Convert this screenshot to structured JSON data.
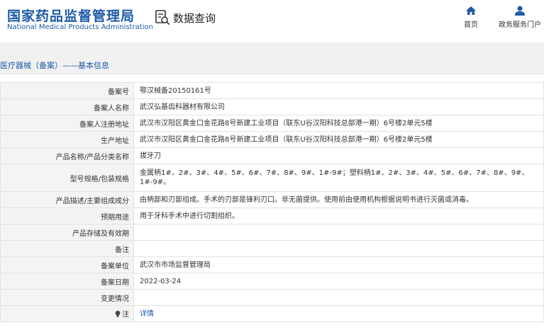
{
  "header": {
    "logo_cn": "国家药品监督管理局",
    "logo_en": "National Medical Products Administration",
    "search_label": "数据查询",
    "nav": [
      {
        "label": "首页",
        "icon": "home-icon"
      },
      {
        "label": "政务服务门户",
        "icon": "user-icon"
      }
    ]
  },
  "colors": {
    "brand": "#1d5aa8",
    "label_bg": "#f4f4f4",
    "section_bg": "#f1f1f1"
  },
  "section_title": "医疗器械（备案）——基本信息",
  "rows": [
    {
      "label": "备案号",
      "value": "鄂汉械备20150161号"
    },
    {
      "label": "备案人名称",
      "value": "武汉弘基齿科器材有限公司"
    },
    {
      "label": "备案人注册地址",
      "value": "武汉市汉阳区黄金口金花路8号新建工业项目（联东U谷汉阳科技总部港一期）6号楼2单元5楼"
    },
    {
      "label": "生产地址",
      "value": "武汉市汉阳区黄金口金花路8号新建工业项目（联东U谷汉阳科技总部港一期）6号楼2单元5楼"
    },
    {
      "label": "产品名称/产品分类名称",
      "value": "拔牙刀"
    },
    {
      "label": "型号规格/包装规格",
      "value": "金属柄1#、2#、3#、4#、5#、6#、7#、8#、9#、1#-9#；塑料柄1#、2#、3#、4#、5#、6#、7#、8#、9#、1#-9#。"
    },
    {
      "label": "产品描述/主要组成成分",
      "value": "由柄部和刃部组成。手术的刃部是锋利刃口。非无菌提供。使用前由使用机构根据说明书进行灭菌或消毒。"
    },
    {
      "label": "预期用途",
      "value": "用于牙科手术中进行切割组织。"
    },
    {
      "label": "产品存储及有效期",
      "value": ""
    },
    {
      "label": "备注",
      "value": ""
    },
    {
      "label": "备案单位",
      "value": "武汉市市场监督管理局"
    },
    {
      "label": "备案日期",
      "value": "2022-03-24"
    },
    {
      "label": "变更情况",
      "value": ""
    },
    {
      "label": "注",
      "value": "详情"
    }
  ]
}
